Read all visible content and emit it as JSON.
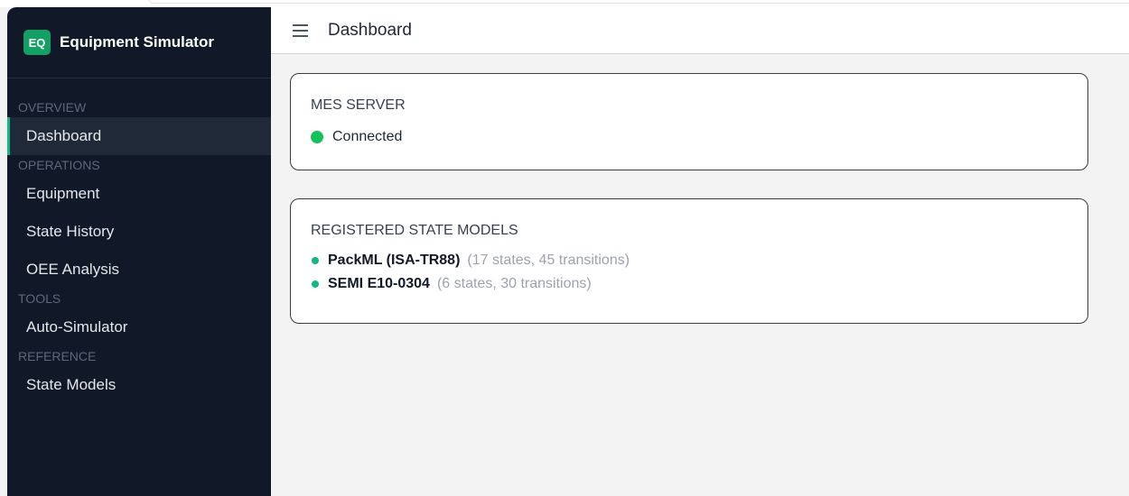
{
  "brand": {
    "badge": "EQ",
    "name": "Equipment Simulator"
  },
  "sidebar": {
    "sections": [
      {
        "label": "OVERVIEW",
        "items": [
          {
            "label": "Dashboard",
            "active": true
          }
        ]
      },
      {
        "label": "OPERATIONS",
        "items": [
          {
            "label": "Equipment"
          },
          {
            "label": "State History"
          },
          {
            "label": "OEE Analysis"
          }
        ]
      },
      {
        "label": "TOOLS",
        "items": [
          {
            "label": "Auto-Simulator"
          }
        ]
      },
      {
        "label": "REFERENCE",
        "items": [
          {
            "label": "State Models"
          }
        ]
      }
    ]
  },
  "header": {
    "title": "Dashboard",
    "menu_icon": "hamburger-menu-icon"
  },
  "mes_card": {
    "title": "MES SERVER",
    "status_text": "Connected",
    "status_color": "#16c05a"
  },
  "models_card": {
    "title": "REGISTERED STATE MODELS",
    "models": [
      {
        "name": "PackML (ISA-TR88)",
        "detail": "(17 states, 45 transitions)"
      },
      {
        "name": "SEMI E10-0304",
        "detail": "(6 states, 30 transitions)"
      }
    ]
  },
  "colors": {
    "sidebar_bg": "#111827",
    "accent": "#10b981",
    "brand_badge": "#12a064"
  }
}
